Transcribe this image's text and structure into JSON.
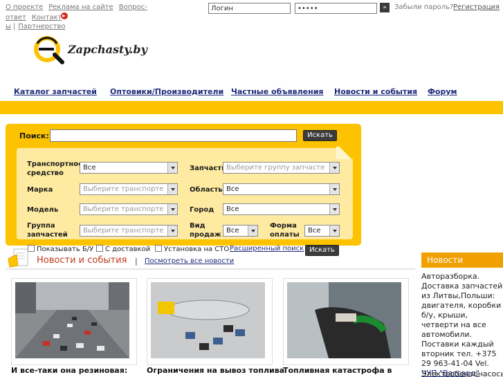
{
  "top_links": {
    "about": "О проекте",
    "ads": "Реклама на сайте",
    "faq": "Вопрос-ответ",
    "contacts": "Контакт",
    "contacts_wrap": "ы",
    "sep": "|",
    "partnership": "Партнерство"
  },
  "login": {
    "username_value": "Логин",
    "password_value": "•••••",
    "go_label": "»",
    "forgot": "Забыли пароль?",
    "register": "Регистрация"
  },
  "logo": {
    "text": "Zapchasty.by"
  },
  "nav": [
    {
      "label": "Каталог запчастей"
    },
    {
      "label": "Оптовики/Производители"
    },
    {
      "label": "Частные объявления"
    },
    {
      "label": "Новости и события"
    },
    {
      "label": "Форум"
    }
  ],
  "search": {
    "label": "Поиск:",
    "value": "",
    "button": "Искать",
    "filters": {
      "transport_label": "Транспортное средство",
      "transport_value": "Все",
      "part_label": "Запчасть",
      "part_value": "Выберите группу запчасте",
      "brand_label": "Марка",
      "brand_value": "Выберите транспорте",
      "region_label": "Область",
      "region_value": "Все",
      "model_label": "Модель",
      "model_value": "Выберите транспорте",
      "city_label": "Город",
      "city_value": "Все",
      "group_label": "Группа запчастей",
      "group_value": "Выберите транспорте",
      "sale_label": "Вид продаж",
      "sale_value": "Все",
      "payment_label": "Форма оплаты",
      "payment_value": "Все"
    },
    "options": {
      "used": "Показывать Б/У",
      "delivery": "С доставкой",
      "install": "Установка на СТО",
      "advanced": "Расширенный поиск"
    },
    "button2": "Искать"
  },
  "news": {
    "title": "Новости и события",
    "sep": "|",
    "all_link": "Посмотреть все новости",
    "items": [
      {
        "caption": "И все-таки она резиновая:"
      },
      {
        "caption": "Ограничения на вывоз топлива"
      },
      {
        "caption": "Топливная катастрофа в"
      }
    ]
  },
  "sidebar": {
    "title": "Новости",
    "text": "Авторазборка. Доставка запчастей из Литвы,Польши: двигателя, коробки б/у, крыши, четверти на все автомобили. Поставки каждый вторник тел. +375 29 963-41-04 Vel.",
    "link": "ЧУП \"Вассард\"",
    "text2": "Электробензонасосы,"
  },
  "colors": {
    "accent_yellow": "#fdc300",
    "nav_link": "#1e2a78",
    "news_title": "#c03a1a",
    "sidebar_head": "#f0a000"
  }
}
